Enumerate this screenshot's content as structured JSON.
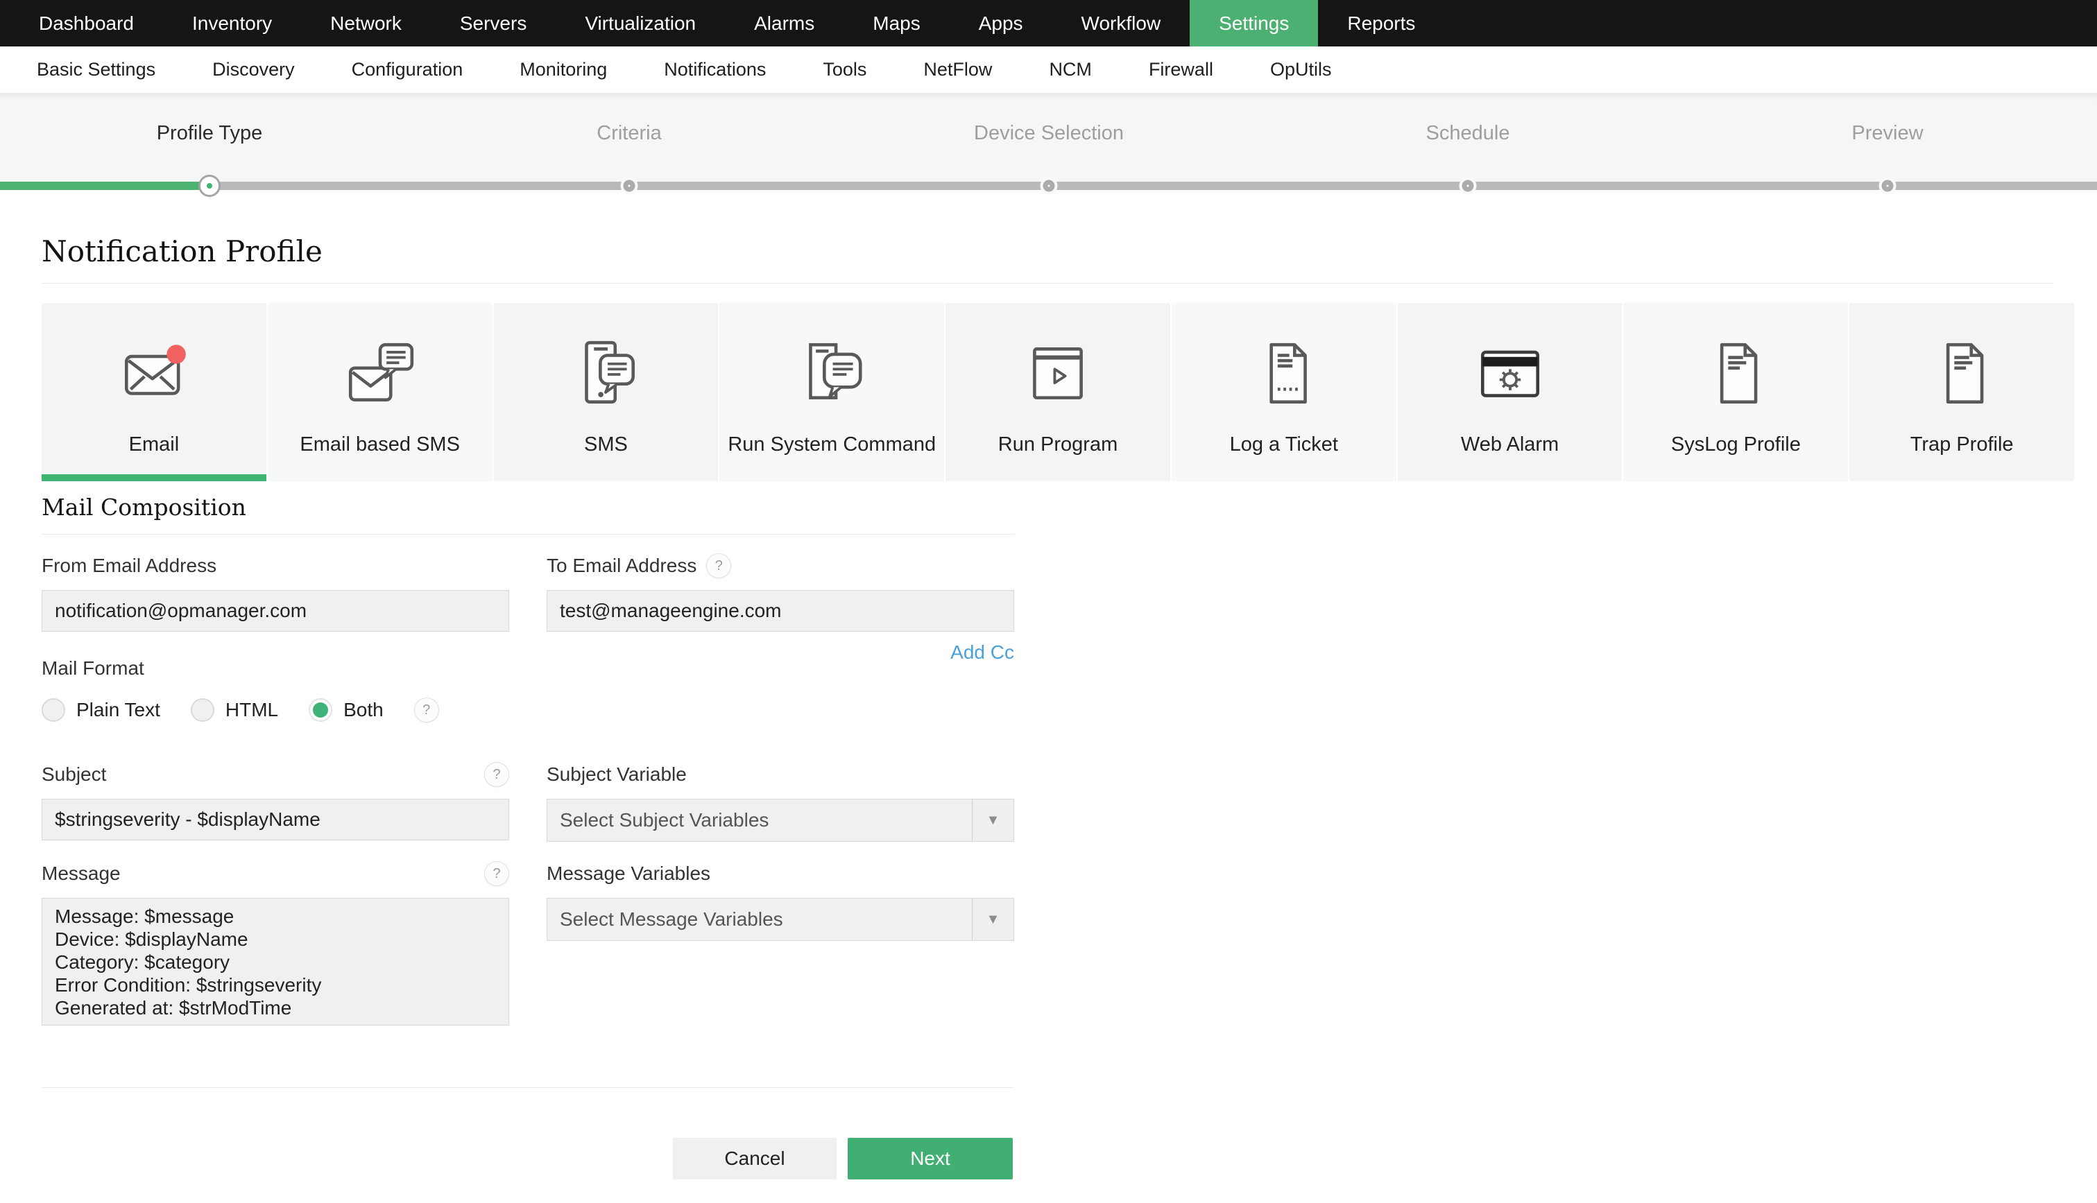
{
  "nav": {
    "items": [
      "Dashboard",
      "Inventory",
      "Network",
      "Servers",
      "Virtualization",
      "Alarms",
      "Maps",
      "Apps",
      "Workflow",
      "Settings",
      "Reports"
    ],
    "active": "Settings"
  },
  "subnav": {
    "items": [
      "Basic Settings",
      "Discovery",
      "Configuration",
      "Monitoring",
      "Notifications",
      "Tools",
      "NetFlow",
      "NCM",
      "Firewall",
      "OpUtils"
    ]
  },
  "stepper": {
    "steps": [
      {
        "label": "Profile Type",
        "state": "active"
      },
      {
        "label": "Criteria",
        "state": "pending"
      },
      {
        "label": "Device Selection",
        "state": "pending"
      },
      {
        "label": "Schedule",
        "state": "pending"
      },
      {
        "label": "Preview",
        "state": "pending"
      }
    ]
  },
  "page": {
    "title": "Notification Profile"
  },
  "cards": {
    "items": [
      {
        "label": "Email",
        "icon": "email-icon",
        "selected": true
      },
      {
        "label": "Email based SMS",
        "icon": "email-based-sms-icon",
        "selected": false
      },
      {
        "label": "SMS",
        "icon": "sms-icon",
        "selected": false
      },
      {
        "label": "Run System Command",
        "icon": "run-system-command-icon",
        "selected": false
      },
      {
        "label": "Run Program",
        "icon": "run-program-icon",
        "selected": false
      },
      {
        "label": "Log a Ticket",
        "icon": "log-a-ticket-icon",
        "selected": false
      },
      {
        "label": "Web Alarm",
        "icon": "web-alarm-icon",
        "selected": false
      },
      {
        "label": "SysLog Profile",
        "icon": "syslog-profile-icon",
        "selected": false
      },
      {
        "label": "Trap Profile",
        "icon": "trap-profile-icon",
        "selected": false
      }
    ]
  },
  "help_glyph": "?",
  "form": {
    "section_title": "Mail Composition",
    "from_email": {
      "label": "From Email Address",
      "value": "notification@opmanager.com"
    },
    "to_email": {
      "label": "To Email Address",
      "value": "test@manageengine.com"
    },
    "add_cc": "Add Cc",
    "mail_format": {
      "label": "Mail Format",
      "options": [
        "Plain Text",
        "HTML",
        "Both"
      ],
      "selected": "Both"
    },
    "subject": {
      "label": "Subject",
      "value": "$stringseverity - $displayName"
    },
    "subject_variable": {
      "label": "Subject Variable",
      "placeholder": "Select Subject Variables"
    },
    "message": {
      "label": "Message",
      "value": "Message: $message\nDevice: $displayName\nCategory: $category\nError Condition: $stringseverity\nGenerated at: $strModTime"
    },
    "message_variables": {
      "label": "Message Variables",
      "placeholder": "Select Message Variables"
    },
    "buttons": {
      "cancel": "Cancel",
      "next": "Next"
    }
  },
  "colors": {
    "accent_green": "#4cb073",
    "progress_green": "#3fb475",
    "link_blue": "#4aa0db",
    "alert_red": "#f0625f",
    "nav_black": "#151515"
  }
}
